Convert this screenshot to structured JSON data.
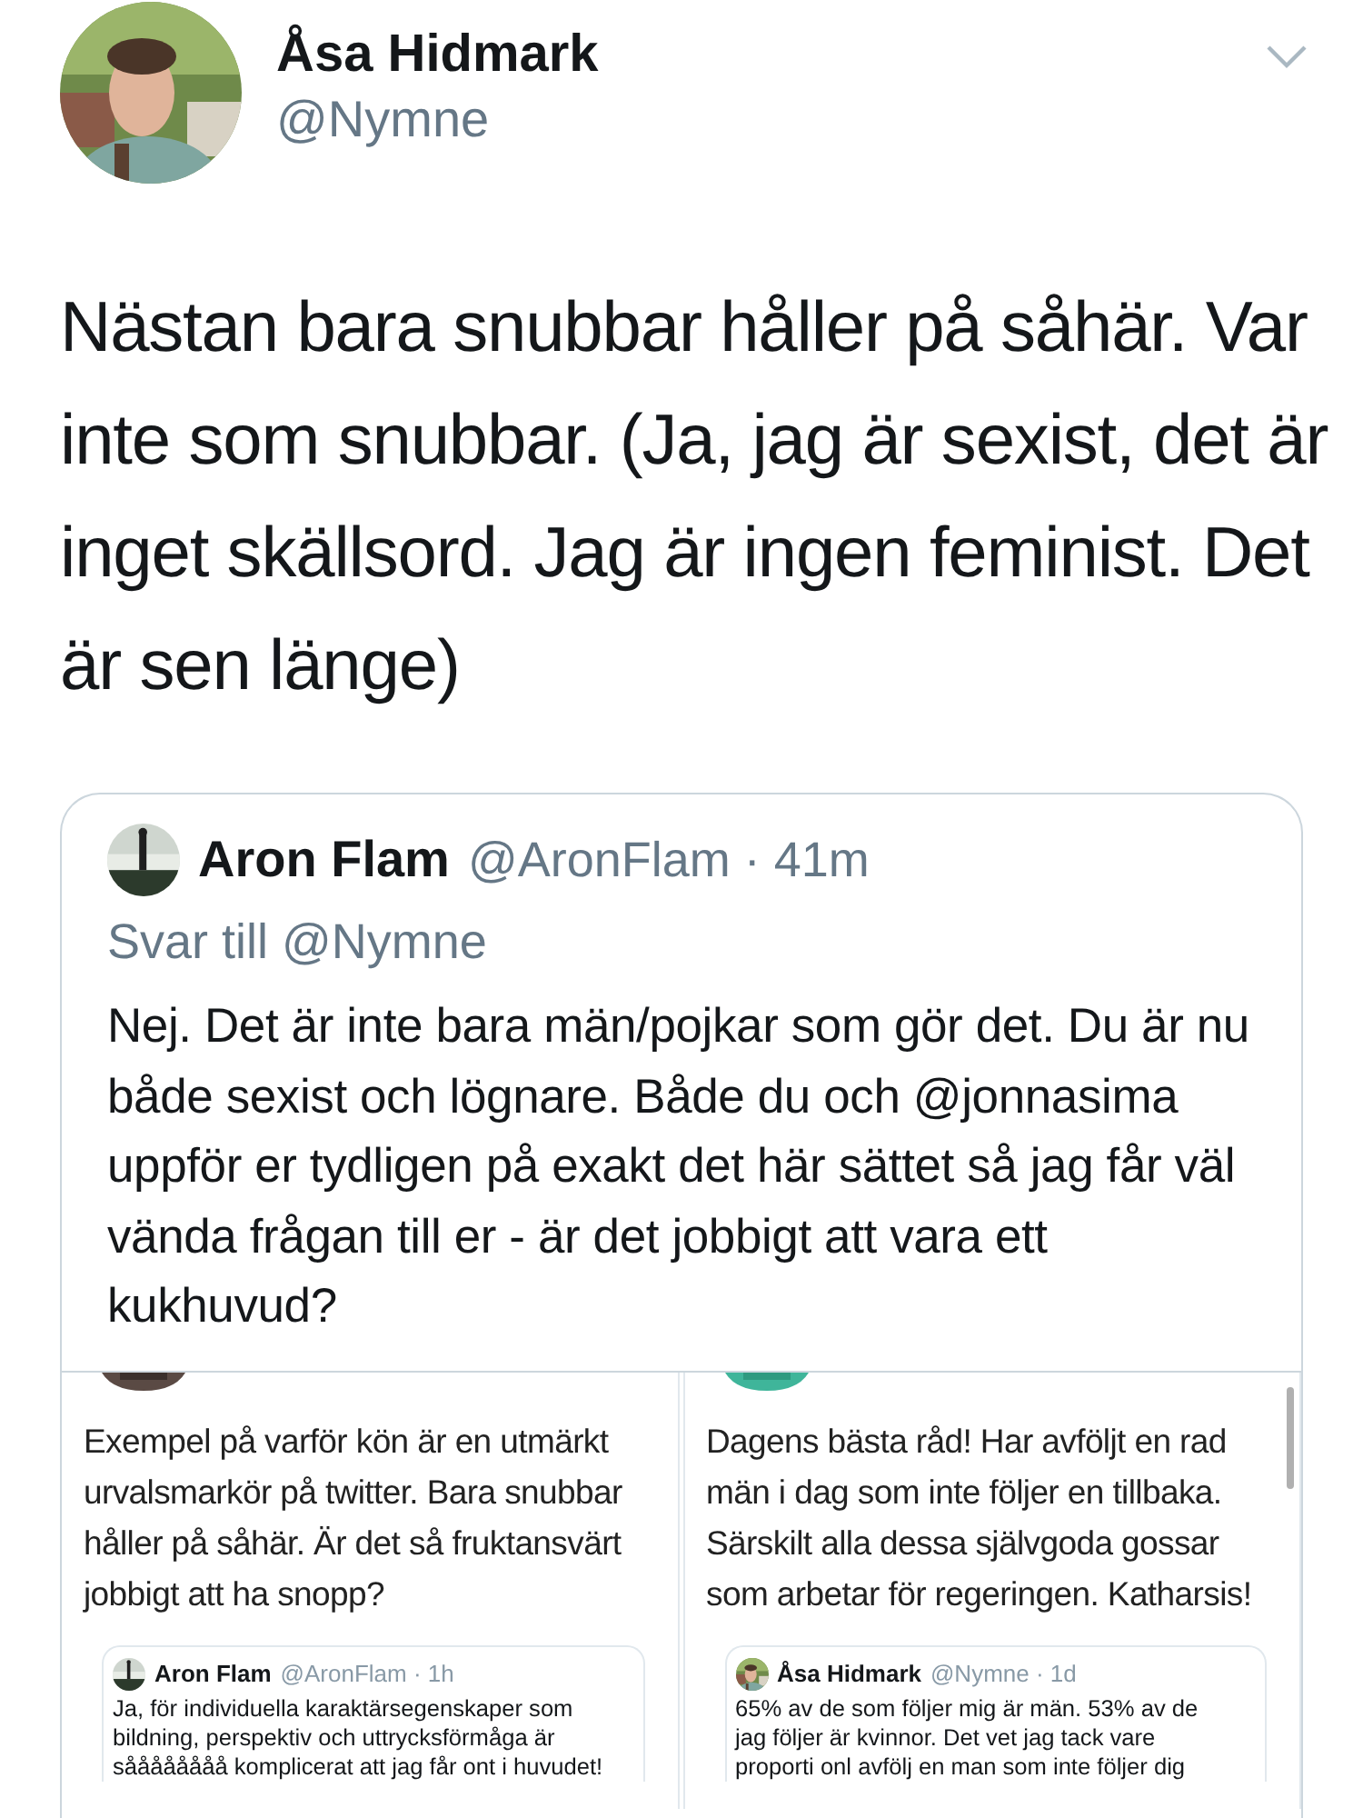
{
  "tweet": {
    "author": {
      "name": "Åsa Hidmark",
      "handle": "@Nymne"
    },
    "text": "Nästan bara snubbar håller på såhär. Var inte som snubbar. (Ja, jag är sexist, det är inget skällsord. Jag är ingen feminist. Det är sen länge)",
    "quote": {
      "author": {
        "name": "Aron Flam",
        "handle_time": "@AronFlam · 41m"
      },
      "reply_to": "Svar till @Nymne",
      "text": "Nej. Det är inte bara män/pojkar som gör det. Du är nu både sexist och lögnare. Både du och @jonnasima uppför er tydligen på exakt det här sättet så jag får väl vända frågan till er - är det jobbigt att vara ett kukhuvud?",
      "media": [
        {
          "text": "Exempel på varför kön är en utmärkt urvalsmarkör på twitter. Bara snubbar håller på såhär. Är det så fruktansvärt jobbigt att ha snopp?",
          "scrollbar": false,
          "quote": {
            "name": "Aron Flam",
            "handle_time": "@AronFlam · 1h",
            "lines": [
              "Ja, för individuella karaktärsegenskaper som",
              "bildning, perspektiv och uttrycksförmåga är",
              "såååååååå komplicerat att jag får ont i huvudet!"
            ]
          }
        },
        {
          "text": "Dagens bästa råd! Har avföljt en rad män i dag som inte följer en tillbaka. Särskilt alla dessa självgoda gossar som arbetar för regeringen. Katharsis!",
          "scrollbar": true,
          "quote": {
            "name": "Åsa Hidmark",
            "handle_time": "@Nymne · 1d",
            "lines": [
              "65% av de som följer mig är män. 53% av de",
              "jag följer är kvinnor. Det vet jag tack vare",
              "proporti onl avfölj en man som inte följer dig"
            ]
          }
        }
      ]
    }
  }
}
